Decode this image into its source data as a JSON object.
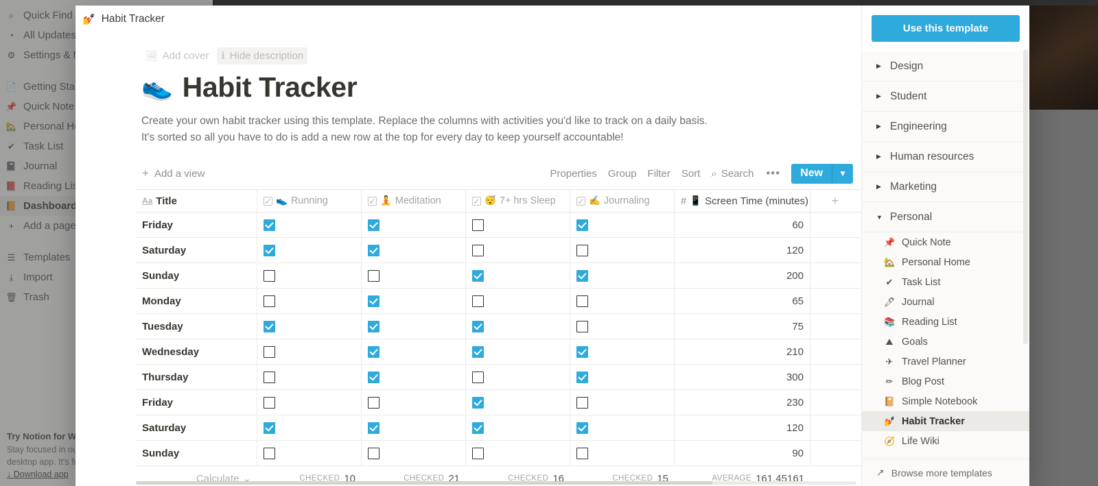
{
  "background_app": {
    "top_items": [
      {
        "icon": "search-icon",
        "glyph": "⌕",
        "label": "Quick Find"
      },
      {
        "icon": "clock-icon",
        "glyph": "◔",
        "label": "All Updates"
      },
      {
        "icon": "gear-icon",
        "glyph": "⚙",
        "label": "Settings & Members"
      }
    ],
    "pages": [
      {
        "icon": "document-icon",
        "glyph": "📄",
        "label": "Getting Started"
      },
      {
        "icon": "pin-icon",
        "glyph": "📌",
        "label": "Quick Note"
      },
      {
        "icon": "house-icon",
        "glyph": "🏡",
        "label": "Personal Home"
      },
      {
        "icon": "check-icon",
        "glyph": "✔",
        "label": "Task List"
      },
      {
        "icon": "notebook-icon",
        "glyph": "📓",
        "label": "Journal"
      },
      {
        "icon": "book-icon",
        "glyph": "📕",
        "label": "Reading List"
      },
      {
        "icon": "orange-book-icon",
        "glyph": "📙",
        "label": "Dashboard",
        "selected": true
      }
    ],
    "add_page": "Add a page",
    "footer_items": [
      {
        "icon": "templates-icon",
        "glyph": "☰",
        "label": "Templates"
      },
      {
        "icon": "import-icon",
        "glyph": "⤓",
        "label": "Import"
      },
      {
        "icon": "trash-icon",
        "glyph": "🗑",
        "label": "Trash"
      }
    ],
    "promo": {
      "title": "Try Notion for Windows",
      "line1": "Stay focused in our",
      "line2": "desktop app. It's free.",
      "download": "↓ Download app"
    }
  },
  "modal": {
    "header": {
      "icon": "pencil-icon",
      "glyph": "💅",
      "title": "Habit Tracker"
    },
    "meta": {
      "add_cover": {
        "icon": "image-icon",
        "glyph": "🖼",
        "label": "Add cover"
      },
      "hide_description": {
        "icon": "info-icon",
        "glyph": "ℹ",
        "label": "Hide description"
      }
    },
    "page": {
      "emoji": "👟",
      "title": "Habit Tracker",
      "description": "Create your own habit tracker using this template. Replace the columns with activities you'd like to track on a daily basis. It's sorted so all you have to do is add a new row at the top for every day to keep yourself accountable!"
    },
    "toolbar": {
      "add_view": "Add a view",
      "items": [
        "Properties",
        "Group",
        "Filter",
        "Sort"
      ],
      "search": {
        "icon": "search-icon",
        "glyph": "⌕",
        "label": "Search"
      },
      "more": "•••",
      "new_button": {
        "label": "New",
        "caret": "▼"
      }
    }
  },
  "table": {
    "columns": [
      {
        "key": "title",
        "type": "title",
        "icon": "aa-icon",
        "glyph": "Aa",
        "label": "Title",
        "emoji": ""
      },
      {
        "key": "running",
        "type": "checkbox",
        "icon": "checkbox-icon",
        "emoji": "👟",
        "label": "Running"
      },
      {
        "key": "meditation",
        "type": "checkbox",
        "icon": "checkbox-icon",
        "emoji": "🧘",
        "label": "Meditation"
      },
      {
        "key": "sleep",
        "type": "checkbox",
        "icon": "checkbox-icon",
        "emoji": "😴",
        "label": "7+ hrs Sleep"
      },
      {
        "key": "journaling",
        "type": "checkbox",
        "icon": "checkbox-icon",
        "emoji": "✍",
        "label": "Journaling"
      },
      {
        "key": "screen_time",
        "type": "number",
        "icon": "hash-icon",
        "glyph": "#",
        "emoji": "📱",
        "label": "Screen Time (minutes)"
      }
    ],
    "add_column_label": "+",
    "rows": [
      {
        "title": "Friday",
        "running": true,
        "meditation": true,
        "sleep": false,
        "journaling": true,
        "screen_time": 60
      },
      {
        "title": "Saturday",
        "running": true,
        "meditation": true,
        "sleep": false,
        "journaling": false,
        "screen_time": 120
      },
      {
        "title": "Sunday",
        "running": false,
        "meditation": false,
        "sleep": true,
        "journaling": true,
        "screen_time": 200
      },
      {
        "title": "Monday",
        "running": false,
        "meditation": true,
        "sleep": false,
        "journaling": false,
        "screen_time": 65
      },
      {
        "title": "Tuesday",
        "running": true,
        "meditation": true,
        "sleep": true,
        "journaling": false,
        "screen_time": 75
      },
      {
        "title": "Wednesday",
        "running": false,
        "meditation": true,
        "sleep": true,
        "journaling": true,
        "screen_time": 210
      },
      {
        "title": "Thursday",
        "running": false,
        "meditation": true,
        "sleep": false,
        "journaling": true,
        "screen_time": 300
      },
      {
        "title": "Friday",
        "running": false,
        "meditation": false,
        "sleep": true,
        "journaling": false,
        "screen_time": 230
      },
      {
        "title": "Saturday",
        "running": true,
        "meditation": true,
        "sleep": true,
        "journaling": true,
        "screen_time": 120
      },
      {
        "title": "Sunday",
        "running": false,
        "meditation": false,
        "sleep": false,
        "journaling": false,
        "screen_time": 90
      }
    ],
    "footer": {
      "calculate": "Calculate",
      "calculate_caret": "⌄",
      "cells": [
        {
          "label": "CHECKED",
          "value": "10"
        },
        {
          "label": "CHECKED",
          "value": "21"
        },
        {
          "label": "CHECKED",
          "value": "16"
        },
        {
          "label": "CHECKED",
          "value": "15"
        },
        {
          "label": "AVERAGE",
          "value": "161.45161"
        }
      ]
    }
  },
  "side_panel": {
    "use_template_button": "Use this template",
    "categories": [
      {
        "label": "Design",
        "expanded": false
      },
      {
        "label": "Student",
        "expanded": false
      },
      {
        "label": "Engineering",
        "expanded": false
      },
      {
        "label": "Human resources",
        "expanded": false
      },
      {
        "label": "Marketing",
        "expanded": false
      },
      {
        "label": "Personal",
        "expanded": true
      }
    ],
    "personal_items": [
      {
        "icon": "pin-icon",
        "glyph": "📌",
        "label": "Quick Note"
      },
      {
        "icon": "house-icon",
        "glyph": "🏡",
        "label": "Personal Home"
      },
      {
        "icon": "check-icon",
        "glyph": "✔",
        "label": "Task List"
      },
      {
        "icon": "pen-icon",
        "glyph": "🖊",
        "label": "Journal"
      },
      {
        "icon": "books-icon",
        "glyph": "📚",
        "label": "Reading List"
      },
      {
        "icon": "mountain-icon",
        "glyph": "⛰",
        "label": "Goals"
      },
      {
        "icon": "airplane-icon",
        "glyph": "✈",
        "label": "Travel Planner"
      },
      {
        "icon": "pencil-icon",
        "glyph": "✏",
        "label": "Blog Post"
      },
      {
        "icon": "notebook-icon",
        "glyph": "📔",
        "label": "Simple Notebook"
      },
      {
        "icon": "nailpolish-icon",
        "glyph": "💅",
        "label": "Habit Tracker",
        "selected": true
      },
      {
        "icon": "compass-icon",
        "glyph": "🧭",
        "label": "Life Wiki"
      }
    ],
    "browse_more": {
      "icon": "arrow-out-icon",
      "glyph": "↗",
      "label": "Browse more templates"
    }
  },
  "colors": {
    "accent_blue": "#2eaadc",
    "text_dark": "#37352f",
    "text_muted": "#8f8f8c",
    "panel_bg": "#fbfaf8",
    "row_border": "#eceae6"
  }
}
